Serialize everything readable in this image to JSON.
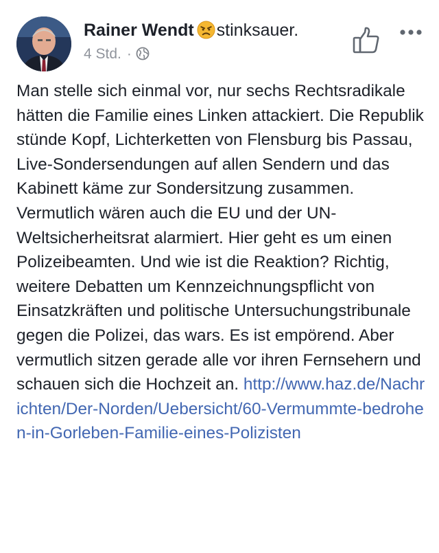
{
  "post": {
    "author": "Rainer Wendt",
    "feeling_icon": "angry-face-emoji",
    "feeling": "stinksauer.",
    "timestamp": "4 Std.",
    "separator": "·",
    "privacy_icon": "globe-icon",
    "actions": {
      "like_icon": "thumbs-up-icon",
      "more_icon": "more-options-icon"
    },
    "text": "Man stelle sich einmal vor, nur sechs Rechtsradikale hätten die Familie eines Linken attackiert. Die Republik stünde Kopf, Lichterketten von Flensburg bis Passau, Live-Sondersendungen auf allen Sendern und das Kabinett käme zur Sondersitzung zusammen. Vermutlich wären auch die EU und der UN-Weltsicherheitsrat alarmiert. Hier geht es um einen Polizeibeamten. Und wie ist die Reaktion? Richtig, weitere Debatten um Kennzeichnungspflicht von Einsatzkräften und politische Untersuchungstribunale gegen die Polizei, das wars. Es ist empörend. Aber vermutlich sitzen gerade alle vor ihren Fernsehern und schauen sich die Hochzeit an.",
    "link": "http://www.haz.de/Nachrichten/Der-Norden/Uebersicht/60-Vermummte-bedrohen-in-Gorleben-Familie-eines-Polizisten"
  },
  "colors": {
    "text": "#1d2129",
    "meta": "#90949c",
    "link": "#4267b2",
    "icon": "#606770"
  }
}
